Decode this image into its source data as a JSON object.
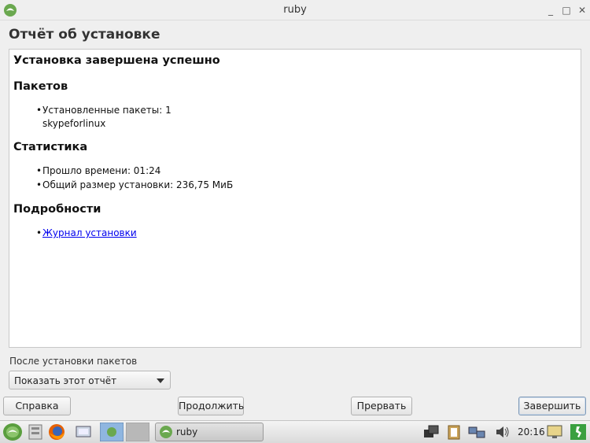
{
  "window": {
    "title": "ruby",
    "minimize_label": "_",
    "maximize_label": "□",
    "close_label": "✕"
  },
  "page": {
    "heading": "Отчёт об установке"
  },
  "report": {
    "status": "Установка завершена успешно",
    "packages_heading": "Пакетов",
    "installed_label": "Установленные пакеты: 1",
    "package_name": "skypeforlinux",
    "stats_heading": "Статистика",
    "elapsed": "Прошло времени: 01:24",
    "size": "Общий размер установки: 236,75 МиБ",
    "details_heading": "Подробности",
    "log_link": "Журнал установки"
  },
  "after_install": {
    "label": "После установки пакетов",
    "selected": "Показать этот отчёт"
  },
  "buttons": {
    "help": "Справка",
    "continue": "Продолжить",
    "abort": "Прервать",
    "finish": "Завершить"
  },
  "taskbar": {
    "task_label": "ruby",
    "clock": "20:16"
  },
  "icons": {
    "app": "ruby-app-icon",
    "start": "start-menu-icon",
    "firefox": "firefox-icon",
    "accent_green": "#6aa84f"
  }
}
